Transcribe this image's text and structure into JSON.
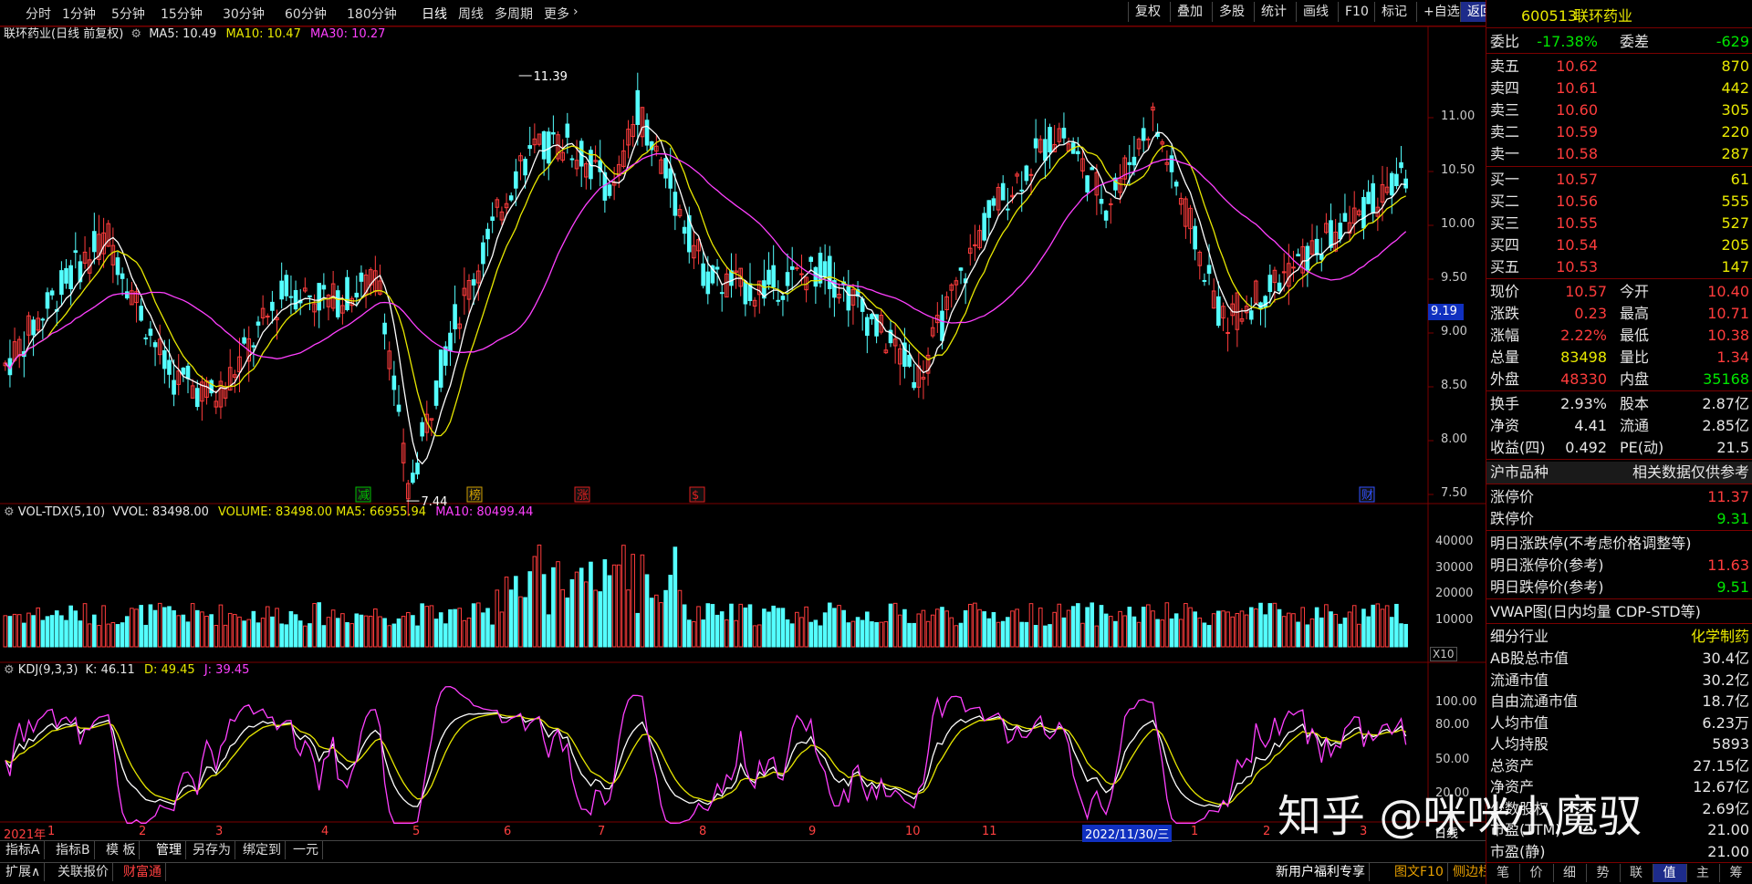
{
  "toolbar": {
    "periods": [
      "分时",
      "1分钟",
      "5分钟",
      "15分钟",
      "30分钟",
      "60分钟",
      "180分钟",
      "日线",
      "周线",
      "多周期",
      "更多"
    ],
    "active_period": "日线",
    "more_icon": "chevron-right-icon",
    "actions": [
      "复权",
      "叠加",
      "多股",
      "统计",
      "画线",
      "F10",
      "标记",
      "+自选",
      "返回"
    ]
  },
  "price_panel": {
    "title": "联环药业(日线 前复权)",
    "ma5": "MA5: 10.49",
    "ma10": "MA10: 10.47",
    "ma30": "MA30: 10.27",
    "high_mark": "11.39",
    "low_mark": "7.44",
    "current_tag": "9.19",
    "axis_ticks": [
      "11.00",
      "10.50",
      "10.00",
      "9.50",
      "9.00",
      "8.50",
      "8.00",
      "7.50"
    ],
    "event_badges": [
      {
        "label": "减",
        "color": "#00c000"
      },
      {
        "label": "榜",
        "color": "#d0a000"
      },
      {
        "label": "涨",
        "color": "#e02020"
      },
      {
        "label": "$",
        "color": "#e02020"
      },
      {
        "label": "财",
        "color": "#3050ff"
      }
    ]
  },
  "volume_panel": {
    "name": "VOL-TDX(5,10)",
    "vvol": "VVOL: 83498.00",
    "volume": "VOLUME: 83498.00",
    "ma5": "MA5: 66955.94",
    "ma10": "MA10: 80499.44",
    "axis_ticks": [
      "40000",
      "30000",
      "20000",
      "10000"
    ],
    "unit": "X10"
  },
  "kdj_panel": {
    "name": "KDJ(9,3,3)",
    "k": "K: 46.11",
    "d": "D: 49.45",
    "j": "J: 39.45",
    "axis_ticks": [
      "100.00",
      "80.00",
      "50.00",
      "20.00"
    ]
  },
  "time_axis": {
    "labels": [
      "2021年",
      "1",
      "2",
      "3",
      "4",
      "5",
      "6",
      "7",
      "8",
      "9",
      "10",
      "11",
      "2022/11/30/三",
      "1",
      "2",
      "3"
    ],
    "period_label": "日线"
  },
  "bottom_tabs": {
    "row1": [
      "指标A",
      "指标B",
      "模 板",
      "管理",
      "另存为",
      "绑定到",
      "一元"
    ],
    "row2": [
      "扩展∧",
      "关联报价",
      "财富通"
    ],
    "right": [
      "新用户福利专享",
      "图文F10",
      "侧边栏 «"
    ]
  },
  "right_panel": {
    "code": "600513",
    "name": "联环药业",
    "weibi_label": "委比",
    "weibi_value": "-17.38%",
    "weicha_label": "委差",
    "weicha_value": "-629",
    "sell": [
      {
        "label": "卖五",
        "price": "10.62",
        "vol": "870"
      },
      {
        "label": "卖四",
        "price": "10.61",
        "vol": "442"
      },
      {
        "label": "卖三",
        "price": "10.60",
        "vol": "305"
      },
      {
        "label": "卖二",
        "price": "10.59",
        "vol": "220"
      },
      {
        "label": "卖一",
        "price": "10.58",
        "vol": "287"
      }
    ],
    "buy": [
      {
        "label": "买一",
        "price": "10.57",
        "vol": "61"
      },
      {
        "label": "买二",
        "price": "10.56",
        "vol": "555"
      },
      {
        "label": "买三",
        "price": "10.55",
        "vol": "527"
      },
      {
        "label": "买四",
        "price": "10.54",
        "vol": "205"
      },
      {
        "label": "买五",
        "price": "10.53",
        "vol": "147"
      }
    ],
    "quote": [
      {
        "l1": "现价",
        "v1": "10.57",
        "l2": "今开",
        "v2": "10.40"
      },
      {
        "l1": "涨跌",
        "v1": "0.23",
        "l2": "最高",
        "v2": "10.71"
      },
      {
        "l1": "涨幅",
        "v1": "2.22%",
        "l2": "最低",
        "v2": "10.38"
      },
      {
        "l1": "总量",
        "v1": "83498",
        "l2": "量比",
        "v2": "1.34"
      },
      {
        "l1": "外盘",
        "v1": "48330",
        "l2": "内盘",
        "v2": "35168"
      }
    ],
    "fund": [
      {
        "l1": "换手",
        "v1": "2.93%",
        "l2": "股本",
        "v2": "2.87亿"
      },
      {
        "l1": "净资",
        "v1": "4.41",
        "l2": "流通",
        "v2": "2.85亿"
      },
      {
        "l1": "收益(四)",
        "v1": "0.492",
        "l2": "PE(动)",
        "v2": "21.5"
      }
    ],
    "market_label": "沪市品种",
    "market_note": "相关数据仅供参考",
    "limit_up_label": "涨停价",
    "limit_up_value": "11.37",
    "limit_down_label": "跌停价",
    "limit_down_value": "9.31",
    "next_title": "明日涨跌停(不考虑价格调整等)",
    "next_up_label": "明日涨停价(参考)",
    "next_up_value": "11.63",
    "next_down_label": "明日跌停价(参考)",
    "next_down_value": "9.51",
    "vwap_title": "VWAP图(日内均量 CDP-STD等)",
    "industry_label": "细分行业",
    "industry_value": "化学制药",
    "stats": [
      {
        "label": "AB股总市值",
        "value": "30.4亿"
      },
      {
        "label": "流通市值",
        "value": "30.2亿"
      },
      {
        "label": "自由流通市值",
        "value": "18.7亿"
      },
      {
        "label": "人均市值",
        "value": "6.23万"
      },
      {
        "label": "人均持股",
        "value": "5893"
      },
      {
        "label": "总资产",
        "value": "27.15亿"
      },
      {
        "label": "净资产",
        "value": "12.67亿"
      },
      {
        "label": "少数股权",
        "value": "2.69亿"
      },
      {
        "label": "市盈(TTM)",
        "value": "21.00"
      },
      {
        "label": "市盈(静)",
        "value": "21.00"
      }
    ],
    "tabs": [
      "笔",
      "价",
      "细",
      "势",
      "联",
      "值",
      "主",
      "筹"
    ],
    "active_tab": "值"
  },
  "watermark": "知乎 @咪咪小魔驭",
  "colors": {
    "up": "#ff3c3c",
    "down": "#54ffff",
    "ma5": "#ffffff",
    "ma10": "#e8e800",
    "ma30": "#ff40ff",
    "border": "#7a0000"
  }
}
